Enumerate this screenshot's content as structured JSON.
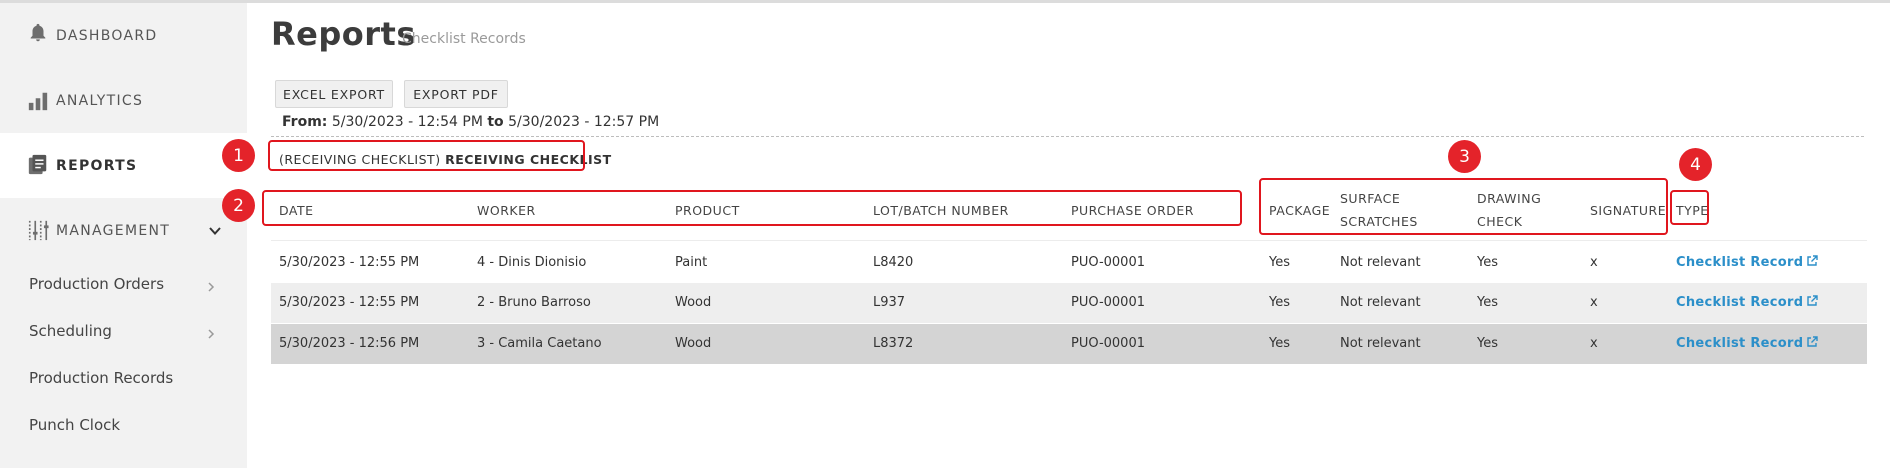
{
  "sidebar": {
    "items": [
      {
        "label": "DASHBOARD",
        "icon": "bell-icon"
      },
      {
        "label": "ANALYTICS",
        "icon": "bar-chart-icon"
      },
      {
        "label": "REPORTS",
        "icon": "report-icon",
        "active": true
      },
      {
        "label": "MANAGEMENT",
        "icon": "sliders-icon",
        "expanded": true
      }
    ],
    "sub_items": [
      {
        "label": "Production Orders",
        "has_chevron": true
      },
      {
        "label": "Scheduling",
        "has_chevron": true
      },
      {
        "label": "Production Records"
      },
      {
        "label": "Punch Clock"
      }
    ]
  },
  "page": {
    "title": "Reports",
    "subtitle": "Checklist Records"
  },
  "toolbar": {
    "excel_label": "EXCEL EXPORT",
    "pdf_label": "EXPORT PDF"
  },
  "range": {
    "from_label": "From:",
    "from_value": "5/30/2023 - 12:54 PM",
    "to_label": "to",
    "to_value": "5/30/2023 - 12:57 PM"
  },
  "checklist": {
    "title_prefix": "(RECEIVING CHECKLIST)",
    "title_name": "RECEIVING CHECKLIST"
  },
  "table": {
    "columns": {
      "date": "DATE",
      "worker": "WORKER",
      "product": "PRODUCT",
      "lot": "LOT/BATCH NUMBER",
      "purchase_order": "PURCHASE ORDER",
      "package": "PACKAGE",
      "surface_1": "SURFACE",
      "surface_2": "SCRATCHES",
      "drawing_1": "DRAWING",
      "drawing_2": "CHECK",
      "signature": "SIGNATURE",
      "type": "TYPE"
    },
    "rows": [
      {
        "date": "5/30/2023 - 12:55 PM",
        "worker": "4 - Dinis Dionisio",
        "product": "Paint",
        "lot": "L8420",
        "purchase_order": "PUO-00001",
        "package": "Yes",
        "surface": "Not relevant",
        "drawing": "Yes",
        "signature": "x",
        "type": "Checklist Record"
      },
      {
        "date": "5/30/2023 - 12:55 PM",
        "worker": "2 - Bruno Barroso",
        "product": "Wood",
        "lot": "L937",
        "purchase_order": "PUO-00001",
        "package": "Yes",
        "surface": "Not relevant",
        "drawing": "Yes",
        "signature": "x",
        "type": "Checklist Record"
      },
      {
        "date": "5/30/2023 - 12:56 PM",
        "worker": "3 - Camila Caetano",
        "product": "Wood",
        "lot": "L8372",
        "purchase_order": "PUO-00001",
        "package": "Yes",
        "surface": "Not relevant",
        "drawing": "Yes",
        "signature": "x",
        "type": "Checklist Record"
      }
    ]
  },
  "annotations": {
    "badges": [
      "1",
      "2",
      "3",
      "4"
    ],
    "color": "#e4232a"
  },
  "colors": {
    "sidebar_bg": "#f2f2f2",
    "link": "#2b8fc9",
    "row_alt": "#eeeeee",
    "row_selected": "#d4d4d4"
  }
}
